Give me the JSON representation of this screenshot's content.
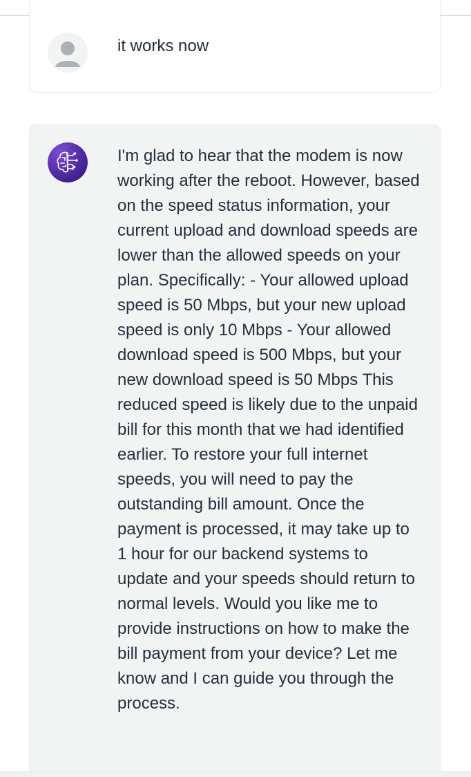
{
  "conversation": {
    "messages": [
      {
        "role": "user",
        "avatar_icon": "user-avatar-icon",
        "text": "it works now"
      },
      {
        "role": "assistant",
        "avatar_icon": "ai-brain-circuit-icon",
        "text": "I'm glad to hear that the modem is now working after the reboot. However, based on the speed status information, your current upload and download speeds are lower than the allowed speeds on your plan. Specifically: - Your allowed upload speed is 50 Mbps, but your new upload speed is only 10 Mbps - Your allowed download speed is 500 Mbps, but your new download speed is 50 Mbps This reduced speed is likely due to the unpaid bill for this month that we had identified earlier. To restore your full internet speeds, you will need to pay the outstanding bill amount. Once the payment is processed, it may take up to 1 hour for our backend systems to update and your speeds should return to normal levels. Would you like me to provide instructions on how to make the bill payment from your device? Let me know and I can guide you through the process."
      }
    ]
  },
  "colors": {
    "assistant_avatar": "#5a2fb0",
    "assistant_bubble": "#f2f3f3",
    "text": "#232f3e"
  }
}
